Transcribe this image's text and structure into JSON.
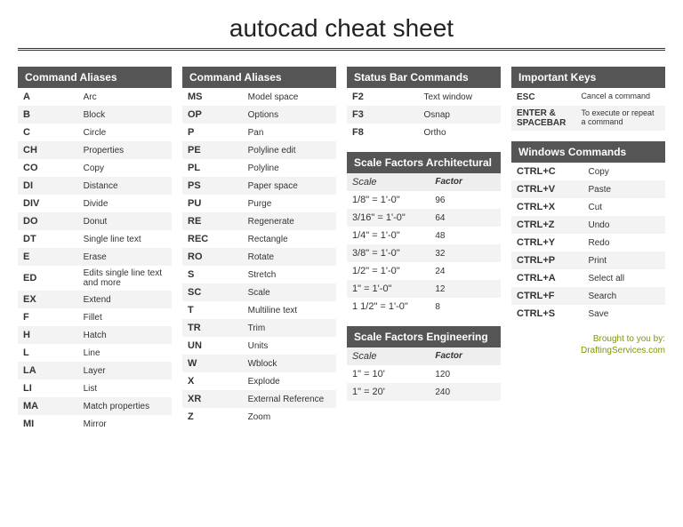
{
  "title": "autocad cheat sheet",
  "aliases1": {
    "header": "Command Aliases",
    "rows": [
      {
        "k": "A",
        "v": "Arc"
      },
      {
        "k": "B",
        "v": "Block"
      },
      {
        "k": "C",
        "v": "Circle"
      },
      {
        "k": "CH",
        "v": "Properties"
      },
      {
        "k": "CO",
        "v": "Copy"
      },
      {
        "k": "DI",
        "v": "Distance"
      },
      {
        "k": "DIV",
        "v": "Divide"
      },
      {
        "k": "DO",
        "v": "Donut"
      },
      {
        "k": "DT",
        "v": "Single line text"
      },
      {
        "k": "E",
        "v": "Erase"
      },
      {
        "k": "ED",
        "v": "Edits single line text and more"
      },
      {
        "k": "EX",
        "v": "Extend"
      },
      {
        "k": "F",
        "v": "Fillet"
      },
      {
        "k": "H",
        "v": "Hatch"
      },
      {
        "k": "L",
        "v": "Line"
      },
      {
        "k": "LA",
        "v": "Layer"
      },
      {
        "k": "LI",
        "v": "List"
      },
      {
        "k": "MA",
        "v": "Match properties"
      },
      {
        "k": "MI",
        "v": "Mirror"
      }
    ]
  },
  "aliases2": {
    "header": "Command Aliases",
    "rows": [
      {
        "k": "MS",
        "v": "Model space"
      },
      {
        "k": "OP",
        "v": "Options"
      },
      {
        "k": "P",
        "v": "Pan"
      },
      {
        "k": "PE",
        "v": "Polyline edit"
      },
      {
        "k": "PL",
        "v": "Polyline"
      },
      {
        "k": "PS",
        "v": "Paper space"
      },
      {
        "k": "PU",
        "v": "Purge"
      },
      {
        "k": "RE",
        "v": "Regenerate"
      },
      {
        "k": "REC",
        "v": "Rectangle"
      },
      {
        "k": "RO",
        "v": "Rotate"
      },
      {
        "k": "S",
        "v": "Stretch"
      },
      {
        "k": "SC",
        "v": "Scale"
      },
      {
        "k": "T",
        "v": "Multiline text"
      },
      {
        "k": "TR",
        "v": "Trim"
      },
      {
        "k": "UN",
        "v": "Units"
      },
      {
        "k": "W",
        "v": "Wblock"
      },
      {
        "k": "X",
        "v": "Explode"
      },
      {
        "k": "XR",
        "v": "External Reference"
      },
      {
        "k": "Z",
        "v": "Zoom"
      }
    ]
  },
  "statusbar": {
    "header": "Status Bar Commands",
    "rows": [
      {
        "k": "F2",
        "v": "Text window"
      },
      {
        "k": "F3",
        "v": "Osnap"
      },
      {
        "k": "F8",
        "v": "Ortho"
      }
    ]
  },
  "scale_arch": {
    "header": "Scale Factors Architectural",
    "sub1": "Scale",
    "sub2": "Factor",
    "rows": [
      {
        "k": "1/8\" = 1'-0\"",
        "v": "96"
      },
      {
        "k": "3/16\" = 1'-0\"",
        "v": "64"
      },
      {
        "k": "1/4\" = 1'-0\"",
        "v": "48"
      },
      {
        "k": "3/8\" = 1'-0\"",
        "v": "32"
      },
      {
        "k": "1/2\" = 1'-0\"",
        "v": "24"
      },
      {
        "k": "1\" = 1'-0\"",
        "v": "12"
      },
      {
        "k": "1 1/2\" = 1'-0\"",
        "v": "8"
      }
    ]
  },
  "scale_eng": {
    "header": "Scale Factors Engineering",
    "sub1": "Scale",
    "sub2": "Factor",
    "rows": [
      {
        "k": "1\" = 10'",
        "v": "120"
      },
      {
        "k": "1\" = 20'",
        "v": "240"
      }
    ]
  },
  "important": {
    "header": "Important Keys",
    "rows": [
      {
        "k": "ESC",
        "v": "Cancel a command"
      },
      {
        "k": "ENTER & SPACEBAR",
        "v": "To execute or repeat a command"
      }
    ]
  },
  "windows": {
    "header": "Windows Commands",
    "rows": [
      {
        "k": "CTRL+C",
        "v": "Copy"
      },
      {
        "k": "CTRL+V",
        "v": "Paste"
      },
      {
        "k": "CTRL+X",
        "v": "Cut"
      },
      {
        "k": "CTRL+Z",
        "v": "Undo"
      },
      {
        "k": "CTRL+Y",
        "v": "Redo"
      },
      {
        "k": "CTRL+P",
        "v": "Print"
      },
      {
        "k": "CTRL+A",
        "v": "Select all"
      },
      {
        "k": "CTRL+F",
        "v": "Search"
      },
      {
        "k": "CTRL+S",
        "v": "Save"
      }
    ]
  },
  "footer": {
    "line1": "Brought to you by:",
    "line2": "DraftingServices.com"
  }
}
